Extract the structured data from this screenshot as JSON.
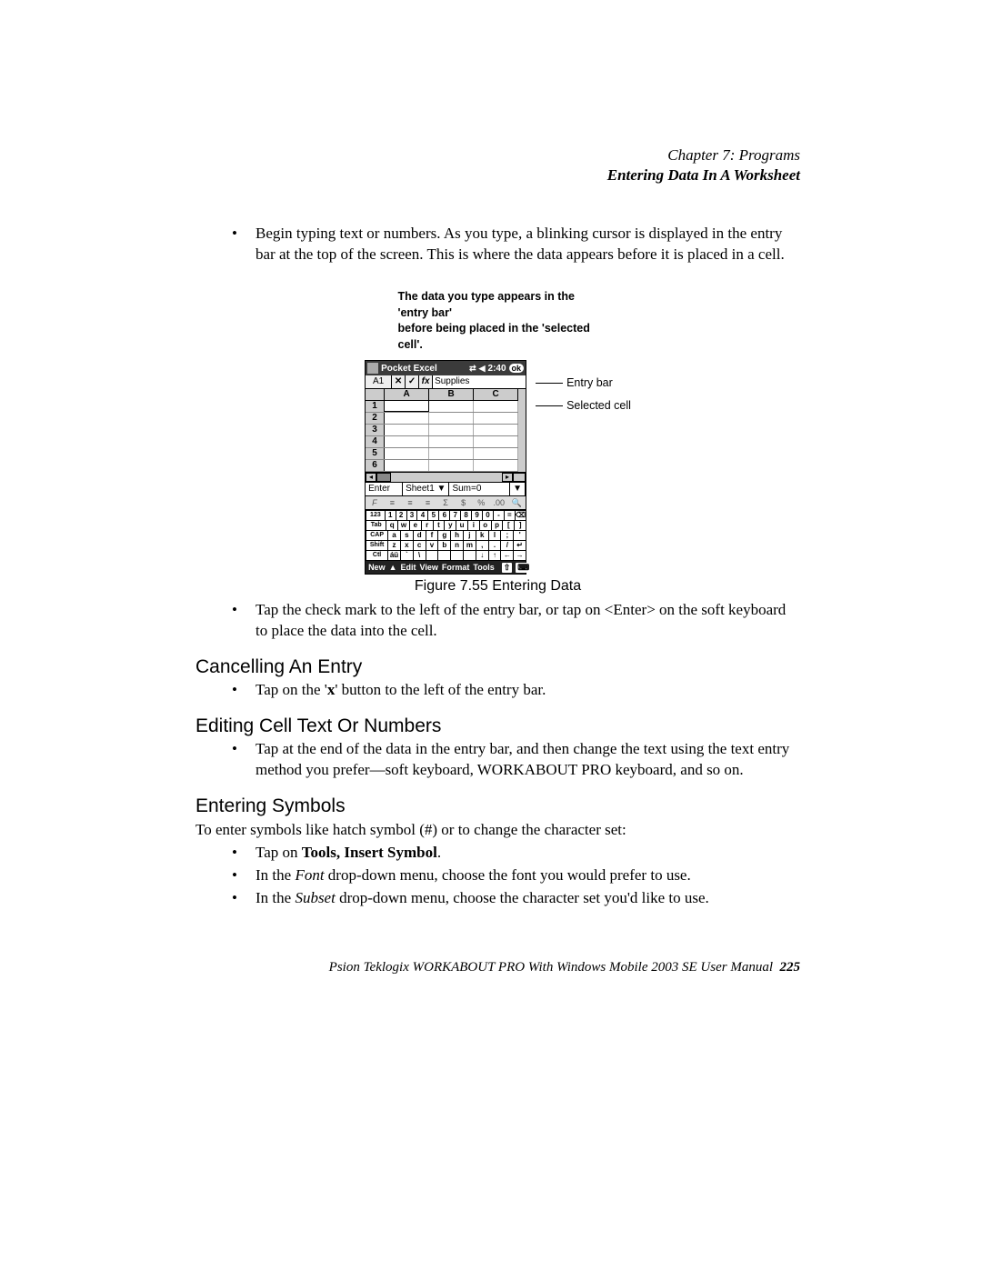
{
  "header": {
    "chapter": "Chapter 7: Programs",
    "section": "Entering Data In A Worksheet"
  },
  "para1_bullet": "Begin typing text or numbers. As you type, a blinking cursor is displayed in the entry bar at the top of the screen. This is where the data appears before it is placed in a cell.",
  "caption_note_line1": "The data you type appears in the 'entry bar'",
  "caption_note_line2": "before being placed in the 'selected cell'.",
  "label_entry_bar": "Entry bar",
  "label_selected_cell": "Selected cell",
  "device": {
    "title": "Pocket Excel",
    "time": "2:40",
    "ok": "ok",
    "cell_ref": "A1",
    "x_btn": "✕",
    "check_btn": "✓",
    "fx_btn": "fx",
    "entry_value": "Supplies",
    "cols": [
      "A",
      "B",
      "C"
    ],
    "rows": [
      "1",
      "2",
      "3",
      "4",
      "5",
      "6"
    ],
    "status_enter": "Enter",
    "status_sheet": "Sheet1 ▼",
    "status_sum": "Sum=0",
    "toolbar_items": [
      "F",
      "≡",
      "≡",
      "≡",
      "Σ",
      "$",
      "%",
      ".00",
      "🔍"
    ],
    "kb_rows": [
      [
        "123",
        "1",
        "2",
        "3",
        "4",
        "5",
        "6",
        "7",
        "8",
        "9",
        "0",
        "-",
        "=",
        "⌫"
      ],
      [
        "Tab",
        "q",
        "w",
        "e",
        "r",
        "t",
        "y",
        "u",
        "i",
        "o",
        "p",
        "[",
        "]"
      ],
      [
        "CAP",
        "a",
        "s",
        "d",
        "f",
        "g",
        "h",
        "j",
        "k",
        "l",
        ";",
        "'"
      ],
      [
        "Shift",
        "z",
        "x",
        "c",
        "v",
        "b",
        "n",
        "m",
        ",",
        ".",
        "/",
        "↵"
      ],
      [
        "Ctl",
        "áü",
        "`",
        "\\",
        "",
        "",
        "",
        "",
        "↓",
        "↑",
        "←",
        "→"
      ]
    ],
    "menu_items": [
      "New",
      "▲",
      "Edit",
      "View",
      "Format",
      "Tools"
    ],
    "menu_icons": [
      "⇧",
      "⌨",
      "▲"
    ]
  },
  "figure_caption": "Figure 7.55 Entering Data",
  "para2_bullet": "Tap the check mark to the left of the entry bar, or tap on <Enter> on the soft keyboard to place the data into the cell.",
  "h_cancel": "Cancelling An Entry",
  "cancel_bullet_pre": "Tap on the '",
  "cancel_bullet_bold": "x",
  "cancel_bullet_post": "' button to the left of the entry bar.",
  "h_edit": "Editing Cell Text Or Numbers",
  "edit_bullet": "Tap at the end of the data in the entry bar, and then change the text using the text entry method you prefer—soft keyboard, WORKABOUT PRO keyboard, and so on.",
  "h_symbols": "Entering Symbols",
  "symbols_intro": "To enter symbols like hatch symbol (#) or to change the character set:",
  "sym_b1_pre": "Tap on ",
  "sym_b1_bold": "Tools, Insert Symbol",
  "sym_b1_post": ".",
  "sym_b2_pre": "In the ",
  "sym_b2_italic": "Font",
  "sym_b2_post": " drop-down menu, choose the font you would prefer to use.",
  "sym_b3_pre": "In the ",
  "sym_b3_italic": "Subset",
  "sym_b3_post": " drop-down menu, choose the character set you'd like to use.",
  "footer_text": "Psion Teklogix WORKABOUT PRO With Windows Mobile 2003 SE User Manual",
  "footer_page": "225"
}
